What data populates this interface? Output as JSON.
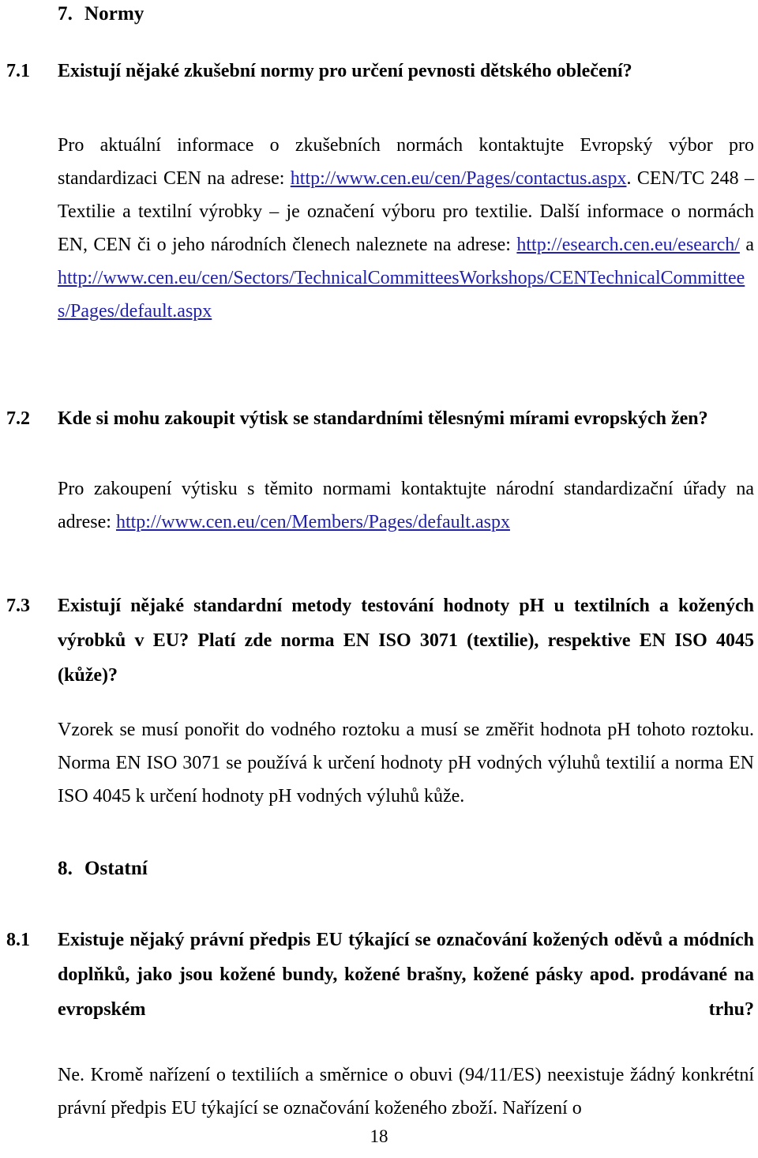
{
  "document": {
    "language": "cs",
    "page_number": "18",
    "link_color": "#2222a8",
    "text_color": "#000000",
    "background_color": "#ffffff"
  },
  "sections": {
    "chapter7": {
      "number": "7.",
      "title": "Normy"
    },
    "chapter8": {
      "number": "8.",
      "title": "Ostatní"
    }
  },
  "questions": {
    "q71": {
      "number": "7.1",
      "heading": "Existují nějaké zkušební normy pro určení pevnosti dětského oblečení?",
      "answer_part1": "Pro aktuální informace o zkušebních normách kontaktujte Evropský výbor pro standardizaci CEN na adrese: ",
      "link1": "http://www.cen.eu/cen/Pages/contactus.aspx",
      "answer_part2": ". CEN/TC 248 – Textilie a textilní výrobky – je označení výboru pro textilie. Další informace o normách EN, CEN či o jeho národních členech naleznete na adrese: ",
      "link2": "http://esearch.cen.eu/esearch/",
      "answer_part3": " a ",
      "link3": "http://www.cen.eu/cen/Sectors/TechnicalCommitteesWorkshops/CENTechnicalCommittees/Pages/default.aspx"
    },
    "q72": {
      "number": "7.2",
      "heading": "Kde si mohu zakoupit výtisk se standardními tělesnými mírami evropských žen?",
      "answer_part1": "Pro zakoupení výtisku s těmito normami kontaktujte národní standardizační úřady na adrese: ",
      "link1": "http://www.cen.eu/cen/Members/Pages/default.aspx"
    },
    "q73": {
      "number": "7.3",
      "heading": "Existují nějaké standardní metody testování hodnoty pH u textilních a kožených výrobků v EU? Platí zde norma EN ISO 3071 (textilie), respektive EN ISO 4045 (kůže)?",
      "answer": "Vzorek se musí ponořit do vodného roztoku a musí se změřit hodnota pH tohoto roztoku. Norma EN ISO 3071 se používá k určení hodnoty pH vodných výluhů textilií a norma EN ISO 4045 k určení hodnoty pH vodných výluhů kůže."
    },
    "q81": {
      "number": "8.1",
      "heading": "Existuje nějaký právní předpis EU týkající se označování kožených oděvů a módních doplňků, jako jsou kožené bundy, kožené brašny, kožené pásky apod. prodávané na evropském trhu?",
      "answer": "Ne. Kromě nařízení o textiliích a směrnice o obuvi (94/11/ES) neexistuje žádný konkrétní právní předpis EU týkající se označování koženého zboží. Nařízení o"
    }
  }
}
